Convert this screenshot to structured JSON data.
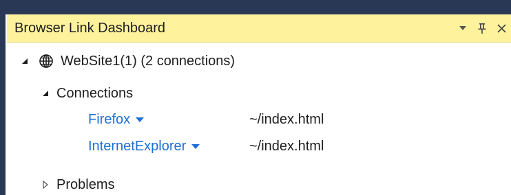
{
  "window": {
    "title": "Browser Link Dashboard"
  },
  "colors": {
    "chrome": "#293955",
    "header": "#fff29d",
    "link": "#1e6fd6",
    "text": "#1e1e1e"
  },
  "tree": {
    "site": {
      "label": "WebSite1(1) (2 connections)",
      "expanded": true,
      "icon": "globe-icon"
    },
    "connections": {
      "label": "Connections",
      "expanded": true,
      "items": [
        {
          "browser": "Firefox",
          "path": "~/index.html"
        },
        {
          "browser": "InternetExplorer",
          "path": "~/index.html"
        }
      ]
    },
    "problems": {
      "label": "Problems",
      "expanded": false
    }
  }
}
